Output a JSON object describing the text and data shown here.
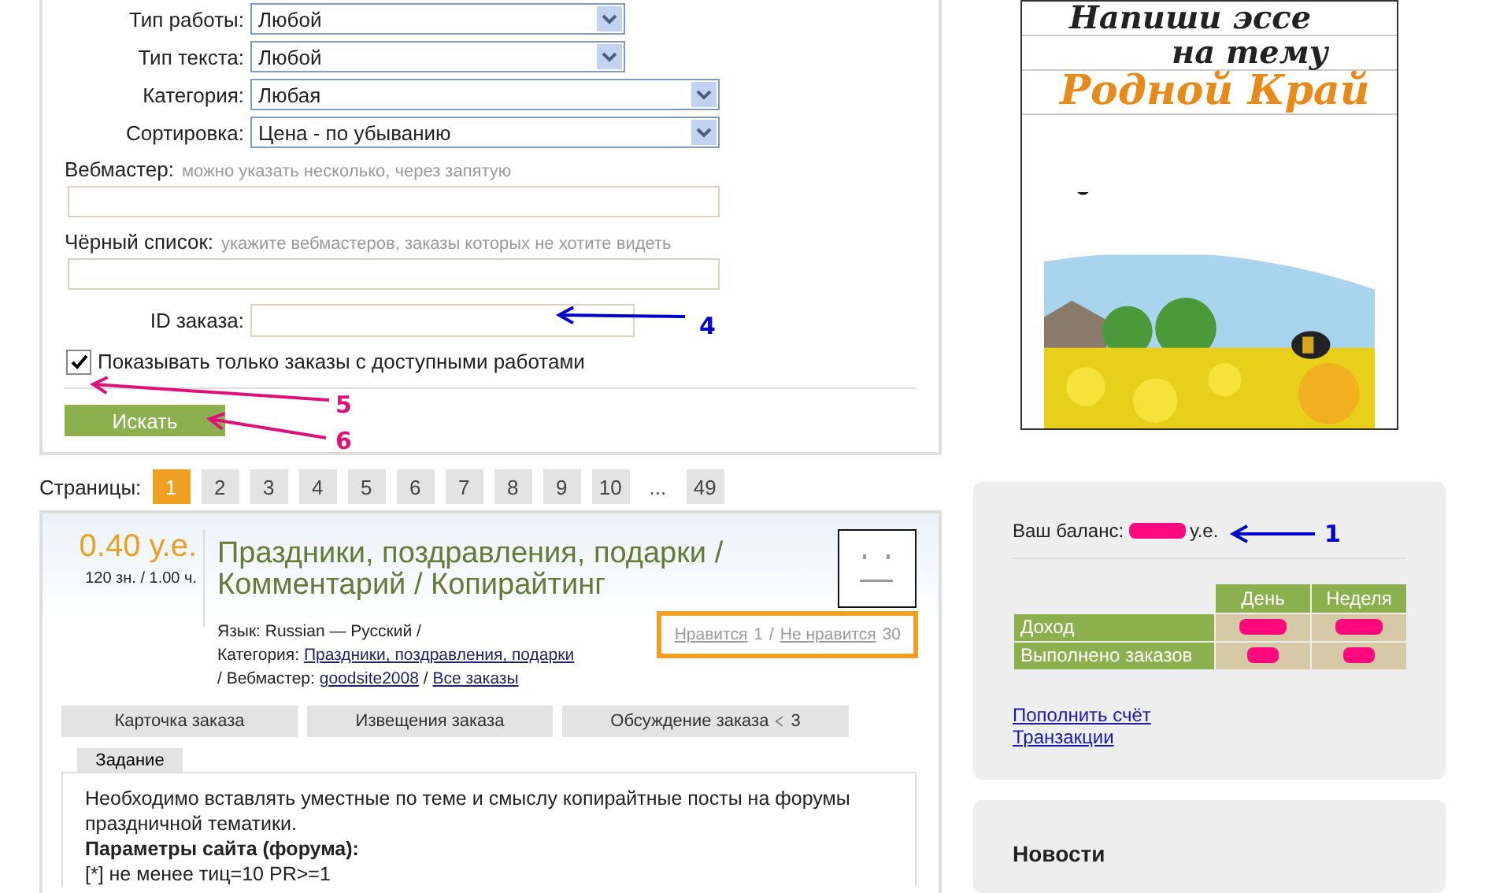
{
  "search_form": {
    "selects": [
      {
        "label": "Тип работы:",
        "value": "Любой",
        "wide": false
      },
      {
        "label": "Тип текста:",
        "value": "Любой",
        "wide": false
      },
      {
        "label": "Категория:",
        "value": "Любая",
        "wide": true
      },
      {
        "label": "Сортировка:",
        "value": "Цена - по убыванию",
        "wide": true
      }
    ],
    "text_filters": [
      {
        "label": "Вебмастер:",
        "hint": "можно указать несколько, через запятую"
      },
      {
        "label": "Чёрный список:",
        "hint": "укажите вебмастеров, заказы которых не хотите видеть"
      }
    ],
    "order_id": {
      "label": "ID заказа:"
    },
    "checkbox": {
      "label": "Показывать только заказы с доступными работами",
      "checked": true
    },
    "search_button": "Искать"
  },
  "pagination": {
    "label": "Страницы:",
    "pages": [
      {
        "label": "1",
        "selected": true
      },
      {
        "label": "2",
        "selected": false
      },
      {
        "label": "3",
        "selected": false
      },
      {
        "label": "4",
        "selected": false
      },
      {
        "label": "5",
        "selected": false
      },
      {
        "label": "6",
        "selected": false
      },
      {
        "label": "7",
        "selected": false
      },
      {
        "label": "8",
        "selected": false
      },
      {
        "label": "9",
        "selected": false
      },
      {
        "label": "10",
        "selected": false
      },
      {
        "label": "...",
        "kind": "gap",
        "selected": false
      },
      {
        "label": "49",
        "selected": false
      }
    ]
  },
  "order": {
    "price": "0.40 у.е.",
    "volume": "120 зн. / 1.00 ч.",
    "title": "Праздники, поздравления, подарки / Комментарий / Копирайтинг",
    "details": [
      {
        "kind": "text",
        "text": "Язык: Russian — Русский /"
      },
      {
        "kind": "break"
      },
      {
        "kind": "text",
        "text": "Категория:"
      },
      {
        "kind": "link",
        "text": "Праздники, поздравления, подарки"
      },
      {
        "kind": "text",
        "text": "/ Вебмастер:"
      },
      {
        "kind": "link",
        "text": "goodsite2008"
      },
      {
        "kind": "text",
        "text": "/"
      },
      {
        "kind": "link",
        "text": "Все заказы"
      }
    ],
    "votes": {
      "like": "Нравится",
      "likes": "1",
      "separator": "/",
      "dislike": "Не нравится",
      "dislikes": "30"
    },
    "tabs": [
      {
        "label": "Карточка заказа"
      },
      {
        "label": "Извещения заказа"
      },
      {
        "label": "Обсуждение заказа",
        "count": "3"
      }
    ],
    "subtabs": [
      {
        "label": "Задание",
        "selected": true
      }
    ],
    "task": {
      "text": "Необходимо вставлять уместные по теме и смыслу копирайтные посты на форумы праздничной тематики.",
      "heading": "Параметры сайта (форума):",
      "cut_line": "[*] не менее тиц=10 PR>=1"
    }
  },
  "banner": {
    "line_1": "Напиши эссе",
    "line_2": "на тему",
    "line_3": "Родной Край"
  },
  "balance": {
    "label": "Ваш баланс:",
    "unit": "у.е.",
    "columns": [
      "День",
      "Неделя"
    ],
    "rows": [
      "Доход",
      "Выполнено заказов"
    ],
    "links": [
      "Пополнить счёт",
      "Транзакции"
    ]
  },
  "news": {
    "title": "Новости"
  },
  "annotations": [
    {
      "label": "1",
      "color": "#0000cc"
    },
    {
      "label": "4",
      "color": "#0000cc"
    },
    {
      "label": "5",
      "color": "#e0107a"
    },
    {
      "label": "6",
      "color": "#e0107a"
    }
  ]
}
